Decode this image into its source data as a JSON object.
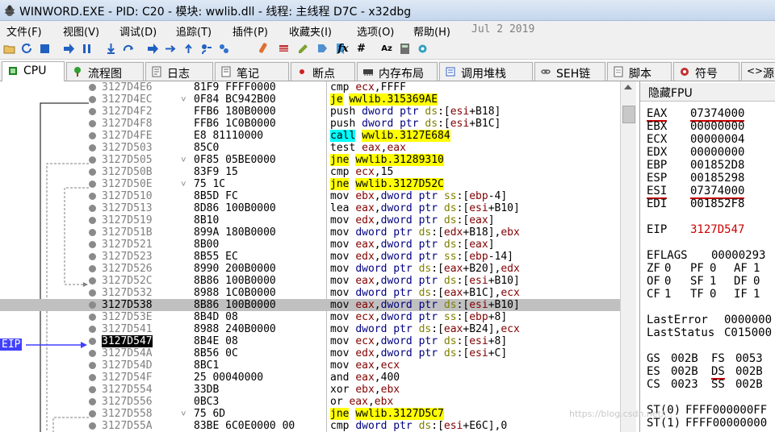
{
  "window": {
    "title": "WINWORD.EXE - PID: C20 - 模块: wwlib.dll - 线程: 主线程 D7C - x32dbg"
  },
  "menu": {
    "items": [
      "文件(F)",
      "视图(V)",
      "调试(D)",
      "追踪(T)",
      "插件(P)",
      "收藏夹(I)",
      "选项(O)",
      "帮助(H)"
    ],
    "date": "Jul  2 2019"
  },
  "toolbar": {
    "icons": [
      "open-icon",
      "restart-icon",
      "stop-icon",
      "run-icon",
      "pause-icon",
      "step-into-icon",
      "step-over-icon",
      "trace-into-icon",
      "trace-over-icon",
      "execute-till-return-icon",
      "run-to-user-code-icon",
      "patch-icon",
      "link-icon",
      "script-icon",
      "comment-icon",
      "label-icon",
      "bookmark-icon",
      "function-icon",
      "hash-icon",
      "font-size-icon",
      "calculator-icon",
      "settings-icon"
    ],
    "fx_label": "fx",
    "hash_label": "#",
    "font_label": "Az"
  },
  "tabs": [
    {
      "label": "CPU",
      "icon": "cpu-icon",
      "active": true
    },
    {
      "label": "流程图",
      "icon": "graph-icon"
    },
    {
      "label": "日志",
      "icon": "log-icon"
    },
    {
      "label": "笔记",
      "icon": "notes-icon"
    },
    {
      "label": "断点",
      "icon": "breakpoint-icon"
    },
    {
      "label": "内存布局",
      "icon": "memory-map-icon"
    },
    {
      "label": "调用堆栈",
      "icon": "call-stack-icon"
    },
    {
      "label": "SEH链",
      "icon": "seh-chain-icon"
    },
    {
      "label": "脚本",
      "icon": "script-icon"
    },
    {
      "label": "符号",
      "icon": "symbols-icon"
    },
    {
      "label": "源",
      "icon": "source-icon"
    }
  ],
  "disasm": {
    "eip_label": "EIP",
    "rows": [
      {
        "addr": "3127D4E6",
        "bytes": "81F9 FFFF0000",
        "instr": "cmp ecx,FFFF"
      },
      {
        "addr": "3127D4EC",
        "bytes": "0F84 BC942B00",
        "instr": "je wwlib.315369AE",
        "arrow": true,
        "hl": "y"
      },
      {
        "addr": "3127D4F2",
        "bytes": "FFB6 180B0000",
        "instr": "push dword ptr ds:[esi+B18]"
      },
      {
        "addr": "3127D4F8",
        "bytes": "FFB6 1C0B0000",
        "instr": "push dword ptr ds:[esi+B1C]"
      },
      {
        "addr": "3127D4FE",
        "bytes": "E8 81110000",
        "instr": "call wwlib.3127E684",
        "hl": "c"
      },
      {
        "addr": "3127D503",
        "bytes": "85C0",
        "instr": "test eax,eax"
      },
      {
        "addr": "3127D505",
        "bytes": "0F85 05BE0000",
        "instr": "jne wwlib.31289310",
        "arrow": true,
        "hl": "y"
      },
      {
        "addr": "3127D50B",
        "bytes": "83F9 15",
        "instr": "cmp ecx,15"
      },
      {
        "addr": "3127D50E",
        "bytes": "75 1C",
        "instr": "jne wwlib.3127D52C",
        "arrow": true,
        "hl": "y"
      },
      {
        "addr": "3127D510",
        "bytes": "8B5D FC",
        "instr": "mov ebx,dword ptr ss:[ebp-4]"
      },
      {
        "addr": "3127D513",
        "bytes": "8D86 100B0000",
        "instr": "lea eax,dword ptr ds:[esi+B10]"
      },
      {
        "addr": "3127D519",
        "bytes": "8B10",
        "instr": "mov edx,dword ptr ds:[eax]"
      },
      {
        "addr": "3127D51B",
        "bytes": "899A 180B0000",
        "instr": "mov dword ptr ds:[edx+B18],ebx"
      },
      {
        "addr": "3127D521",
        "bytes": "8B00",
        "instr": "mov eax,dword ptr ds:[eax]"
      },
      {
        "addr": "3127D523",
        "bytes": "8B55 EC",
        "instr": "mov edx,dword ptr ss:[ebp-14]"
      },
      {
        "addr": "3127D526",
        "bytes": "8990 200B0000",
        "instr": "mov dword ptr ds:[eax+B20],edx"
      },
      {
        "addr": "3127D52C",
        "bytes": "8B86 100B0000",
        "instr": "mov eax,dword ptr ds:[esi+B10]"
      },
      {
        "addr": "3127D532",
        "bytes": "8988 1C0B0000",
        "instr": "mov dword ptr ds:[eax+B1C],ecx"
      },
      {
        "addr": "3127D538",
        "bytes": "8B86 100B0000",
        "instr": "mov eax,dword ptr ds:[esi+B10]",
        "selected": true
      },
      {
        "addr": "3127D53E",
        "bytes": "8B4D 08",
        "instr": "mov ecx,dword ptr ss:[ebp+8]"
      },
      {
        "addr": "3127D541",
        "bytes": "8988 240B0000",
        "instr": "mov dword ptr ds:[eax+B24],ecx"
      },
      {
        "addr": "3127D547",
        "bytes": "8B4E 08",
        "instr": "mov ecx,dword ptr ds:[esi+8]",
        "eip": true
      },
      {
        "addr": "3127D54A",
        "bytes": "8B56 0C",
        "instr": "mov edx,dword ptr ds:[esi+C]"
      },
      {
        "addr": "3127D54D",
        "bytes": "8BC1",
        "instr": "mov eax,ecx"
      },
      {
        "addr": "3127D54F",
        "bytes": "25 00040000",
        "instr": "and eax,400"
      },
      {
        "addr": "3127D554",
        "bytes": "33DB",
        "instr": "xor ebx,ebx"
      },
      {
        "addr": "3127D556",
        "bytes": "0BC3",
        "instr": "or eax,ebx"
      },
      {
        "addr": "3127D558",
        "bytes": "75 6D",
        "instr": "jne wwlib.3127D5C7",
        "arrow": true,
        "hl": "y"
      },
      {
        "addr": "3127D55A",
        "bytes": "83BE 6C0E0000 00",
        "instr": "cmp dword ptr ds:[esi+E6C],0"
      }
    ]
  },
  "registers": {
    "header": "隐藏FPU",
    "general": [
      {
        "name": "EAX",
        "value": "07374000",
        "changed": true
      },
      {
        "name": "EBX",
        "value": "00000000"
      },
      {
        "name": "ECX",
        "value": "00000004"
      },
      {
        "name": "EDX",
        "value": "00000000"
      },
      {
        "name": "EBP",
        "value": "001852D8"
      },
      {
        "name": "ESP",
        "value": "00185298"
      },
      {
        "name": "ESI",
        "value": "07374000",
        "changed": true
      },
      {
        "name": "EDI",
        "value": "001852F8"
      }
    ],
    "eip": {
      "name": "EIP",
      "value": "3127D547"
    },
    "eflags": {
      "name": "EFLAGS",
      "value": "00000293"
    },
    "flags": [
      [
        "ZF",
        "0",
        "PF",
        "0",
        "AF",
        "1"
      ],
      [
        "OF",
        "0",
        "SF",
        "1",
        "DF",
        "0"
      ],
      [
        "CF",
        "1",
        "TF",
        "0",
        "IF",
        "1"
      ]
    ],
    "last_error": {
      "name": "LastError",
      "value": "0000000"
    },
    "last_status": {
      "name": "LastStatus",
      "value": "C015000"
    },
    "segments": [
      [
        "GS",
        "002B",
        "FS",
        "0053"
      ],
      [
        "ES",
        "002B",
        "DS",
        "002B"
      ],
      [
        "CS",
        "0023",
        "SS",
        "002B"
      ]
    ],
    "fpu": [
      {
        "name": "ST(0)",
        "value": "FFFF000000FF"
      },
      {
        "name": "ST(1)",
        "value": "FFFF00000000"
      }
    ]
  },
  "watermark": "https://blog.csdn.net/..."
}
